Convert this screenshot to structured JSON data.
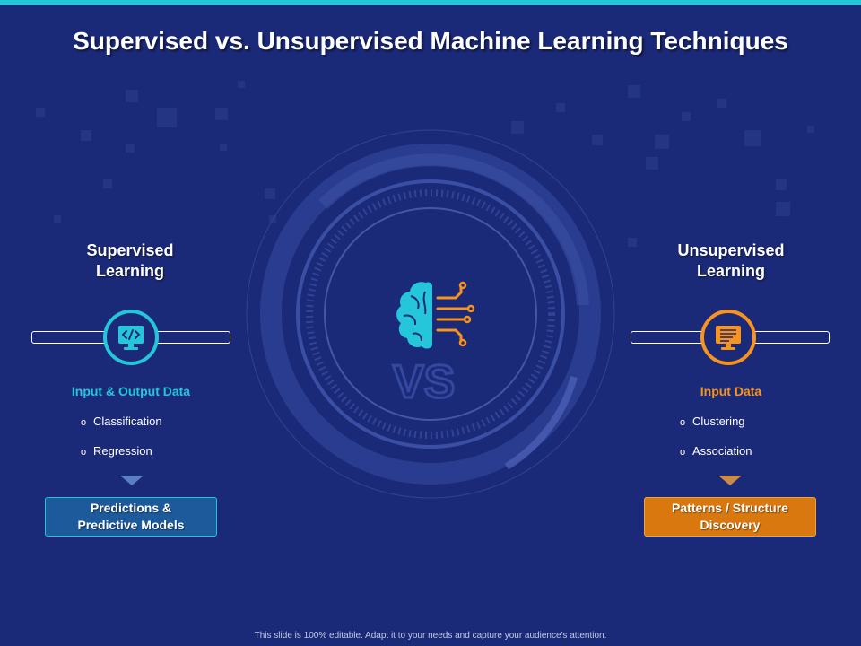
{
  "slide": {
    "title": "Supervised vs. Unsupervised Machine Learning Techniques",
    "footer": "This slide is 100% editable. Adapt it to your needs and capture your audience's attention."
  },
  "center": {
    "vs_text": "VS",
    "brain_icon": "brain-circuit-icon"
  },
  "supervised": {
    "heading_line1": "Supervised",
    "heading_line2": "Learning",
    "icon": "monitor-code-icon",
    "data_label": "Input & Output Data",
    "bullets": [
      "Classification",
      "Regression"
    ],
    "result_line1": "Predictions &",
    "result_line2": "Predictive Models",
    "accent": "#25c6da"
  },
  "unsupervised": {
    "heading_line1": "Unsupervised",
    "heading_line2": "Learning",
    "icon": "monitor-document-icon",
    "data_label": "Input Data",
    "bullets": [
      "Clustering",
      "Association"
    ],
    "result_line1": "Patterns / Structure",
    "result_line2": "Discovery",
    "accent": "#f7931e"
  },
  "colors": {
    "background": "#1b2a78",
    "top_bar": "#25c6da",
    "teal": "#25c6da",
    "orange": "#f7931e",
    "result_left_bg": "#1c5a9c",
    "result_right_bg": "#d9780f"
  }
}
